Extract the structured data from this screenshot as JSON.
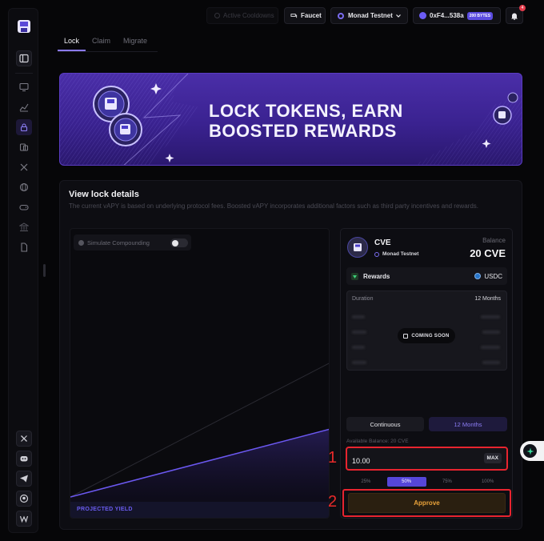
{
  "header": {
    "cooldowns_label": "Active Cooldowns",
    "faucet_label": "Faucet",
    "network_label": "Monad Testnet",
    "wallet_address": "0xF4...538a",
    "bytes_badge": "200 BYTES",
    "notification_count": "4"
  },
  "tabs": [
    {
      "label": "Lock",
      "active": true
    },
    {
      "label": "Claim",
      "active": false
    },
    {
      "label": "Migrate",
      "active": false
    }
  ],
  "banner": {
    "title": "LOCK TOKENS, EARN\nBOOSTED REWARDS"
  },
  "details": {
    "title": "View lock details",
    "description": "The current vAPY is based on underlying protocol fees. Boosted vAPY incorporates additional factors such as third party incentives and rewards."
  },
  "chart": {
    "simulate_label": "Simulate Compounding",
    "simulate_on": false,
    "projected_label": "PROJECTED YIELD"
  },
  "token": {
    "symbol": "CVE",
    "network": "Monad Testnet",
    "balance_label": "Balance",
    "balance_value": "20 CVE"
  },
  "rewards": {
    "label": "Rewards",
    "token": "USDC"
  },
  "duration": {
    "label": "Duration",
    "value": "12 Months",
    "coming_soon": "COMING SOON"
  },
  "modes": {
    "continuous": "Continuous",
    "months": "12 Months"
  },
  "amount": {
    "available": "Available Balance: 20 CVE",
    "value": "10.00",
    "max_label": "MAX"
  },
  "percent_options": [
    {
      "label": "25%",
      "active": false
    },
    {
      "label": "50%",
      "active": true
    },
    {
      "label": "75%",
      "active": false
    },
    {
      "label": "100%",
      "active": false
    }
  ],
  "approve_label": "Approve",
  "annotations": {
    "marker_1": "1",
    "marker_2": "2"
  },
  "colors": {
    "accent": "#6c5cf5",
    "highlight_box": "#e8242f",
    "approve_text": "#e9a23a"
  }
}
